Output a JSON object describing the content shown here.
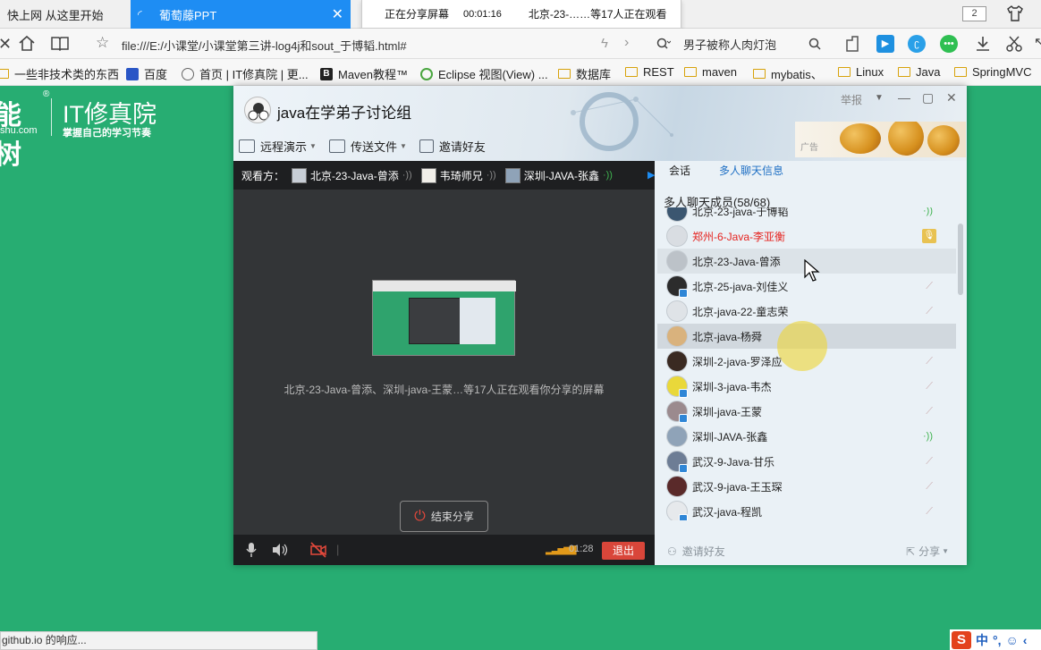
{
  "browser": {
    "tabs": [
      {
        "label": "快上网 从这里开始",
        "active": false
      },
      {
        "label": "葡萄藤PPT",
        "active": true
      }
    ],
    "tab_count": "2",
    "url": "file:///E:/小课堂/小课堂第三讲-log4j和sout_于博韬.html#",
    "search_text": "男子被称人肉灯泡",
    "bookmarks": [
      "一些非技术类的东西",
      "百度",
      "首页 | IT修真院 | 更...",
      "Maven教程™",
      "Eclipse 视图(View) ...",
      "数据库",
      "REST",
      "maven",
      "mybatis、",
      "Linux",
      "Java",
      "SpringMVC"
    ],
    "status_text": "github.io 的响应...",
    "ime": {
      "lang": "中",
      "punct": "°,"
    }
  },
  "share_bar": {
    "status": "正在分享屏幕",
    "elapsed": "00:01:16",
    "viewers_summary": "北京-23-……等17人正在观看"
  },
  "page": {
    "logo_glyph": "能树",
    "logo_domain": "shu.com",
    "logo_title": "IT修真院",
    "logo_slogan": "掌握自己的学习节奏"
  },
  "qq": {
    "group_name": "java在学弟子讨论组",
    "report_label": "举报",
    "toolbar": [
      {
        "label": "远程演示",
        "dropdown": true
      },
      {
        "label": "传送文件",
        "dropdown": true
      },
      {
        "label": "邀请好友",
        "dropdown": false
      }
    ],
    "ad_label": "广告",
    "viewers_label": "观看方：",
    "viewers": [
      "北京-23-Java-曾添",
      "韦琦师兄",
      "深圳-JAVA-张鑫"
    ],
    "share_message": "北京-23-Java-曾添、深圳-java-王蒙…等17人正在观看你分享的屏幕",
    "stop_share_label": "结束分享",
    "call_time": "01:28",
    "exit_label": "退出",
    "side_tabs": [
      "会话",
      "多人聊天信息"
    ],
    "members_title": "多人聊天成员(58/68)",
    "members": [
      {
        "name": "北京-23-java-于博韬",
        "status": "green",
        "color": "#3b5670",
        "badge": false
      },
      {
        "name": "郑州-6-Java-李亚衡",
        "status": "mic",
        "color": "#d9dde2",
        "badge": false,
        "red": true
      },
      {
        "name": "北京-23-Java-曾添",
        "status": "",
        "color": "#bcc2c8",
        "badge": false
      },
      {
        "name": "北京-25-java-刘佳义",
        "status": "muted",
        "color": "#2c2c2c",
        "badge": true
      },
      {
        "name": "北京-java-22-童志荣",
        "status": "muted",
        "color": "#dfe3e7",
        "badge": false
      },
      {
        "name": "北京-java-杨舜",
        "status": "",
        "color": "#d9b27d",
        "badge": false
      },
      {
        "name": "深圳-2-java-罗泽应",
        "status": "muted",
        "color": "#3a2a22",
        "badge": false
      },
      {
        "name": "深圳-3-java-韦杰",
        "status": "muted",
        "color": "#e9d83a",
        "badge": true
      },
      {
        "name": "深圳-java-王蒙",
        "status": "muted",
        "color": "#9b8a8e",
        "badge": true
      },
      {
        "name": "深圳-JAVA-张鑫",
        "status": "green",
        "color": "#8fa3b8",
        "badge": false
      },
      {
        "name": "武汉-9-Java-甘乐",
        "status": "muted",
        "color": "#6d7d95",
        "badge": true
      },
      {
        "name": "武汉-9-java-王玉琛",
        "status": "muted",
        "color": "#5a2a2a",
        "badge": false
      },
      {
        "name": "武汉-java-程凯",
        "status": "muted",
        "color": "#e6e9ec",
        "badge": true
      }
    ],
    "invite_label": "邀请好友",
    "share_label": "分享"
  }
}
